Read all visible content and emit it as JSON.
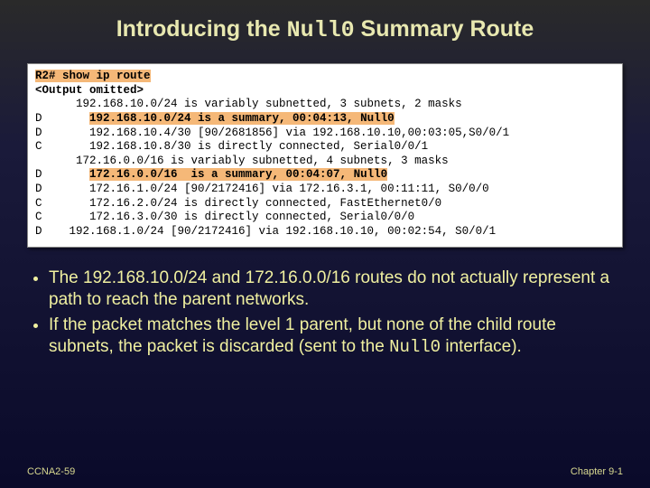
{
  "title": {
    "prefix": "Introducing the ",
    "mono": "Null0",
    "suffix": " Summary Route"
  },
  "terminal": {
    "prompt": "R2# ",
    "cmd": "show ip route",
    "omit": "<Output omitted>",
    "line1": "      192.168.10.0/24 is variably subnetted, 3 subnets, 2 masks",
    "line2a": "D       ",
    "line2b": "192.168.10.0/24 is a summary, 00:04:13, Null0",
    "line3": "D       192.168.10.4/30 [90/2681856] via 192.168.10.10,00:03:05,S0/0/1",
    "line4": "C       192.168.10.8/30 is directly connected, Serial0/0/1",
    "line5": "      172.16.0.0/16 is variably subnetted, 4 subnets, 3 masks",
    "line6a": "D       ",
    "line6b": "172.16.0.0/16  is a summary, 00:04:07, Null0",
    "line7": "D       172.16.1.0/24 [90/2172416] via 172.16.3.1, 00:11:11, S0/0/0",
    "line8": "C       172.16.2.0/24 is directly connected, FastEthernet0/0",
    "line9": "C       172.16.3.0/30 is directly connected, Serial0/0/0",
    "line10": "D    192.168.1.0/24 [90/2172416] via 192.168.10.10, 00:02:54, S0/0/1"
  },
  "bullets": {
    "b1": "The 192.168.10.0/24 and 172.16.0.0/16 routes do not actually represent a path to reach the parent networks.",
    "b2a": "If the packet matches the level 1 parent, but none of the child route subnets, the packet is discarded (sent to the ",
    "b2mono": "Null0",
    "b2b": " interface)."
  },
  "footer": {
    "left": "CCNA2-59",
    "right": "Chapter  9-1"
  }
}
